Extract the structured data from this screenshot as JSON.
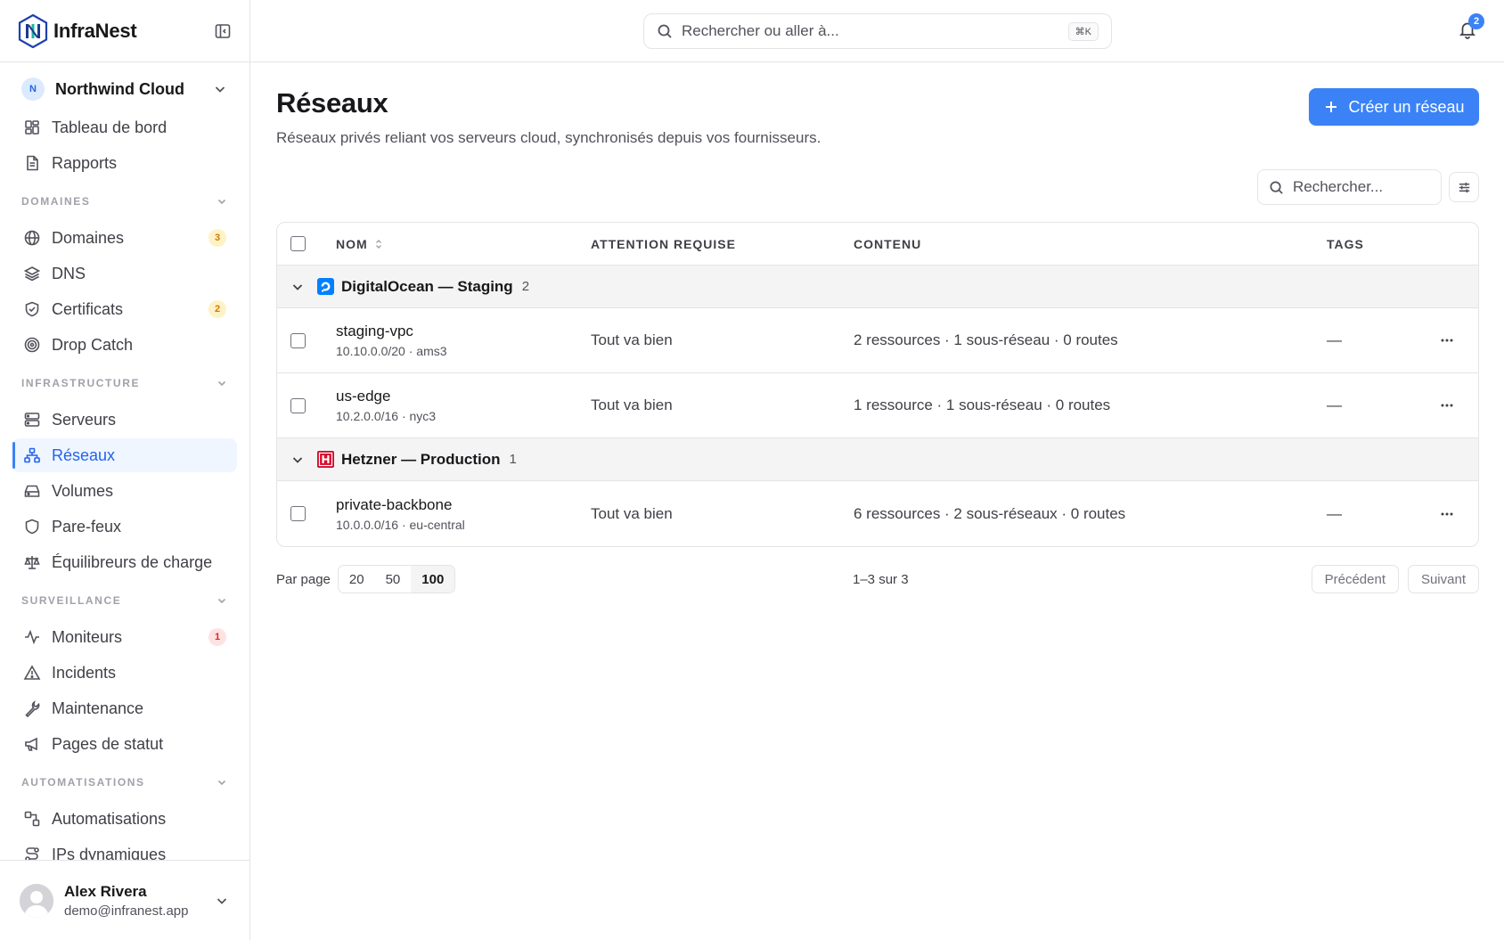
{
  "brand": {
    "name": "InfraNest"
  },
  "org": {
    "initial": "N",
    "name": "Northwind Cloud"
  },
  "nav_top": [
    {
      "label": "Tableau de bord",
      "icon": "dashboard-icon"
    },
    {
      "label": "Rapports",
      "icon": "report-icon"
    }
  ],
  "sections": {
    "domaines": {
      "title": "DOMAINES",
      "items": [
        {
          "label": "Domaines",
          "icon": "globe-icon",
          "badge": "3"
        },
        {
          "label": "DNS",
          "icon": "layers-icon"
        },
        {
          "label": "Certificats",
          "icon": "shield-check-icon",
          "badge": "2"
        },
        {
          "label": "Drop Catch",
          "icon": "target-icon"
        }
      ]
    },
    "infrastructure": {
      "title": "INFRASTRUCTURE",
      "items": [
        {
          "label": "Serveurs",
          "icon": "server-icon"
        },
        {
          "label": "Réseaux",
          "icon": "network-icon",
          "active": true
        },
        {
          "label": "Volumes",
          "icon": "drive-icon"
        },
        {
          "label": "Pare-feux",
          "icon": "shield-icon"
        },
        {
          "label": "Équilibreurs de charge",
          "icon": "scale-icon"
        }
      ]
    },
    "surveillance": {
      "title": "SURVEILLANCE",
      "items": [
        {
          "label": "Moniteurs",
          "icon": "activity-icon",
          "badge": "1"
        },
        {
          "label": "Incidents",
          "icon": "alert-triangle-icon"
        },
        {
          "label": "Maintenance",
          "icon": "wrench-icon"
        },
        {
          "label": "Pages de statut",
          "icon": "megaphone-icon"
        }
      ]
    },
    "automatisations": {
      "title": "AUTOMATISATIONS",
      "items": [
        {
          "label": "Automatisations",
          "icon": "workflow-icon"
        },
        {
          "label": "IPs dynamiques",
          "icon": "route-icon"
        }
      ]
    }
  },
  "user": {
    "name": "Alex Rivera",
    "email": "demo@infranest.app"
  },
  "topbar": {
    "search_placeholder": "Rechercher ou aller à...",
    "shortcut": "⌘K",
    "notifications": "2"
  },
  "page": {
    "title": "Réseaux",
    "subtitle": "Réseaux privés reliant vos serveurs cloud, synchronisés depuis vos fournisseurs.",
    "create_label": "Créer un réseau",
    "search_placeholder": "Rechercher..."
  },
  "table": {
    "columns": {
      "name": "NOM",
      "attention": "ATTENTION REQUISE",
      "content": "CONTENU",
      "tags": "TAGS"
    },
    "groups": [
      {
        "provider": "DigitalOcean — Staging",
        "count": "2",
        "color": "#0080ff",
        "rows": [
          {
            "name": "staging-vpc",
            "sub": "10.10.0.0/20 · ams3",
            "attention": "Tout va bien",
            "content": "2 ressources · 1 sous-réseau · 0 routes",
            "tags": "—"
          },
          {
            "name": "us-edge",
            "sub": "10.2.0.0/16 · nyc3",
            "attention": "Tout va bien",
            "content": "1 ressource · 1 sous-réseau · 0 routes",
            "tags": "—"
          }
        ]
      },
      {
        "provider": "Hetzner — Production",
        "count": "1",
        "color": "#d50c2d",
        "rows": [
          {
            "name": "private-backbone",
            "sub": "10.0.0.0/16 · eu-central",
            "attention": "Tout va bien",
            "content": "6 ressources · 2 sous-réseaux · 0 routes",
            "tags": "—"
          }
        ]
      }
    ]
  },
  "pager": {
    "per_page_label": "Par page",
    "options": [
      "20",
      "50",
      "100"
    ],
    "selected": "100",
    "range": "1–3 sur 3",
    "prev": "Précédent",
    "next": "Suivant"
  },
  "colors": {
    "accent": "#3b82f6",
    "active_bg": "#eff6ff"
  }
}
